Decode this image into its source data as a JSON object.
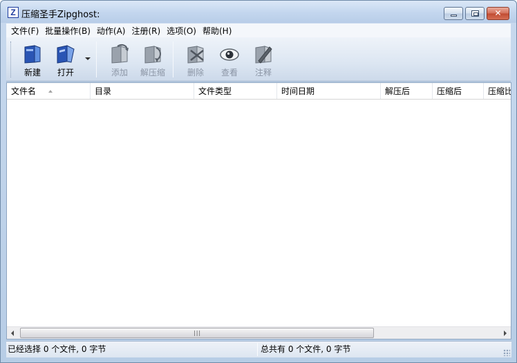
{
  "window": {
    "title": "压缩圣手Zipghost:",
    "app_icon_letter": "Z"
  },
  "menu": [
    {
      "label": "文件(F)"
    },
    {
      "label": "批量操作(B)"
    },
    {
      "label": "动作(A)"
    },
    {
      "label": "注册(R)"
    },
    {
      "label": "选项(O)"
    },
    {
      "label": "帮助(H)"
    }
  ],
  "toolbar": {
    "buttons": [
      {
        "label": "新建",
        "icon": "new-archive-icon",
        "enabled": true
      },
      {
        "label": "打开",
        "icon": "open-archive-icon",
        "enabled": true
      },
      {
        "label": "添加",
        "icon": "add-files-icon",
        "enabled": false
      },
      {
        "label": "解压缩",
        "icon": "extract-icon",
        "enabled": false
      },
      {
        "label": "删除",
        "icon": "delete-icon",
        "enabled": false
      },
      {
        "label": "查看",
        "icon": "view-eye-icon",
        "enabled": false
      },
      {
        "label": "注释",
        "icon": "comment-pencil-icon",
        "enabled": false
      }
    ]
  },
  "list": {
    "columns": [
      "文件名",
      "目录",
      "文件类型",
      "时间日期",
      "解压后",
      "压缩后",
      "压缩比"
    ],
    "sorted_column": "文件名",
    "rows": []
  },
  "status": {
    "selected": "已经选择 0 个文件, 0 字节",
    "total": "总共有 0 个文件, 0 字节"
  },
  "colors": {
    "frame": "#c3d6ee",
    "disabled_text": "#8b95a5",
    "close_button": "#c14b31"
  }
}
